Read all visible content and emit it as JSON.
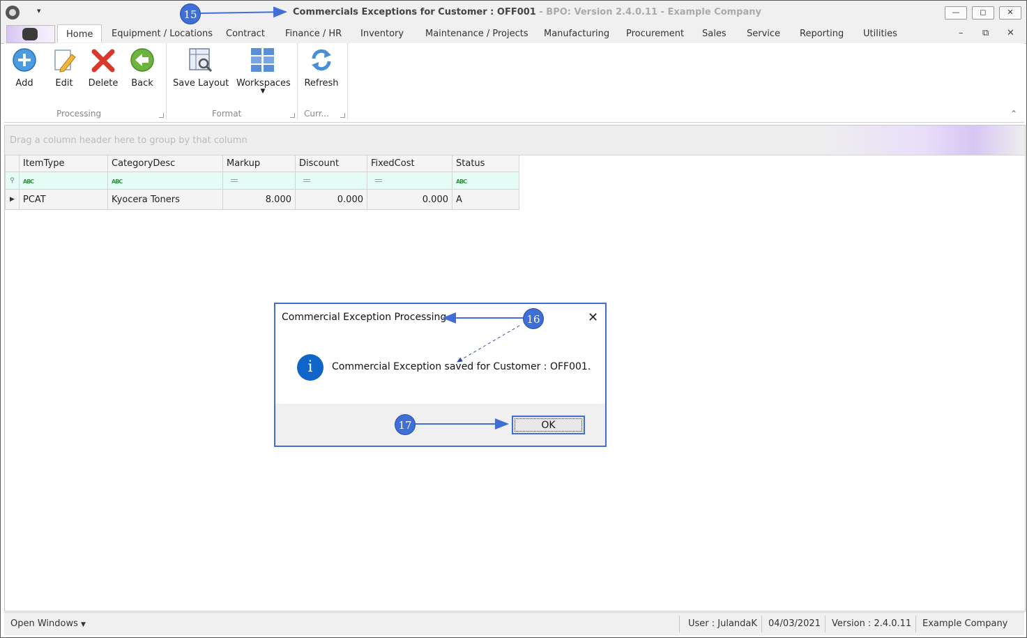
{
  "window": {
    "title_main": "Commercials Exceptions for Customer : OFF001",
    "title_sub": " - BPO: Version 2.4.0.11 - Example Company",
    "min_label": "—",
    "max_label": "◻",
    "close_label": "✕"
  },
  "tabs": [
    {
      "label": "Home"
    },
    {
      "label": "Equipment / Locations"
    },
    {
      "label": "Contract"
    },
    {
      "label": "Finance / HR"
    },
    {
      "label": "Inventory"
    },
    {
      "label": "Maintenance / Projects"
    },
    {
      "label": "Manufacturing"
    },
    {
      "label": "Procurement"
    },
    {
      "label": "Sales"
    },
    {
      "label": "Service"
    },
    {
      "label": "Reporting"
    },
    {
      "label": "Utilities"
    }
  ],
  "ribbon": {
    "buttons": {
      "add": "Add",
      "edit": "Edit",
      "delete": "Delete",
      "back": "Back",
      "save_layout": "Save Layout",
      "workspaces": "Workspaces",
      "refresh": "Refresh"
    },
    "groups": {
      "processing": "Processing",
      "format": "Format",
      "curr": "Curr..."
    }
  },
  "grid": {
    "group_hint": "Drag a column header here to group by that column",
    "columns": [
      "ItemType",
      "CategoryDesc",
      "Markup",
      "Discount",
      "FixedCost",
      "Status"
    ],
    "rows": [
      {
        "item_type": "PCAT",
        "category_desc": "Kyocera Toners",
        "markup": "8.000",
        "discount": "0.000",
        "fixed_cost": "0.000",
        "status": "A"
      }
    ]
  },
  "statusbar": {
    "open_windows": "Open Windows",
    "user": "User : JulandaK",
    "date": "04/03/2021",
    "version": "Version : 2.4.0.11",
    "company": "Example Company"
  },
  "dialog": {
    "title": "Commercial Exception Processing",
    "message": "Commercial Exception saved for Customer : OFF001.",
    "ok_label": "OK",
    "close_label": "✕"
  },
  "callouts": [
    "15",
    "16",
    "17"
  ],
  "colors": {
    "accent_blue": "#3f6fd6",
    "info_blue": "#0f65c8",
    "filter_row": "#e4fbf6",
    "delete_red": "#d9392b",
    "back_green": "#6cb33f"
  }
}
